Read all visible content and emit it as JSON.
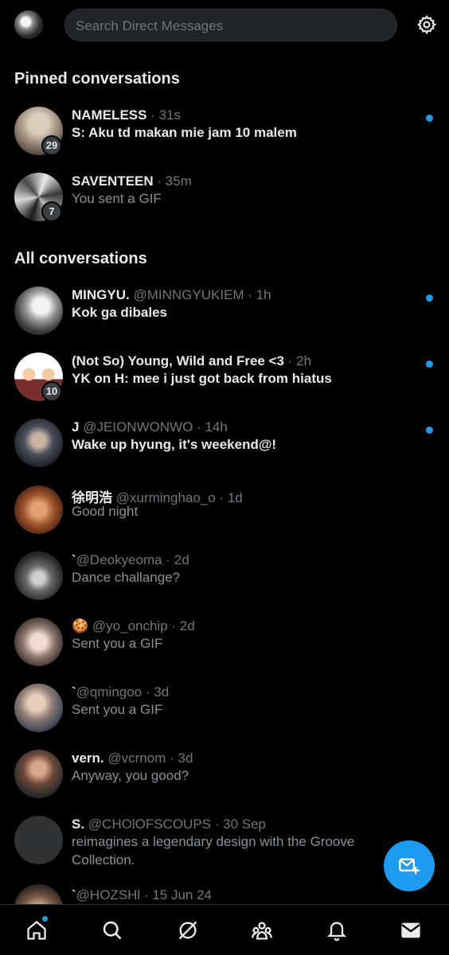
{
  "header": {
    "search_placeholder": "Search Direct Messages"
  },
  "sections": {
    "pinned_title": "Pinned conversations",
    "all_title": "All conversations"
  },
  "pinned": [
    {
      "name": "NAMELESS",
      "handle": "",
      "time": "31s",
      "message": "S: Aku td makan mie jam 10 malem",
      "unread": true,
      "badge": "29"
    },
    {
      "name": "SAVENTEEN",
      "handle": "",
      "time": "35m",
      "message": "You sent a GIF",
      "unread": false,
      "badge": "7"
    }
  ],
  "conversations": [
    {
      "name": "MINGYU.",
      "handle": "@MINNGYUKIEM",
      "time": "1h",
      "message": "Kok ga dibales",
      "unread": true,
      "badge": ""
    },
    {
      "name": "(Not So) Young, Wild and Free <3",
      "handle": "",
      "time": "2h",
      "message": "YK on H: mee i just got back from hiatus",
      "unread": true,
      "badge": "10"
    },
    {
      "name": "J",
      "handle": "@JEIONWONWO",
      "time": "14h",
      "message": "Wake up hyung, it's weekend@!",
      "unread": true,
      "badge": ""
    },
    {
      "name": "徐明浩",
      "handle": "@xurminghao_o",
      "time": "1d",
      "message": "Good night",
      "unread": false,
      "badge": ""
    },
    {
      "name": "`",
      "handle": "@Deokyeoma",
      "time": "2d",
      "message": "Dance challange?",
      "unread": false,
      "badge": ""
    },
    {
      "name": "🍪",
      "handle": "@yo_onchip",
      "time": "2d",
      "message": "Sent you a GIF",
      "unread": false,
      "badge": ""
    },
    {
      "name": "`",
      "handle": "@qmingoo",
      "time": "3d",
      "message": "Sent you a GIF",
      "unread": false,
      "badge": ""
    },
    {
      "name": "vern.",
      "handle": "@vcrnom",
      "time": "3d",
      "message": "Anyway, you good?",
      "unread": false,
      "badge": ""
    },
    {
      "name": "S.",
      "handle": "@CHOlOFSCOUPS",
      "time": "30 Sep",
      "message": "reimagines a legendary design with the Groove",
      "message2": "Collection.",
      "unread": false,
      "badge": ""
    },
    {
      "name": "`",
      "handle": "@HOZSHl",
      "time": "15 Jun 24",
      "message": "",
      "unread": false,
      "badge": ""
    }
  ],
  "icons": {
    "settings": "gear-icon",
    "compose": "new-message-icon",
    "nav": [
      "home-icon",
      "search-icon",
      "grok-icon",
      "communities-icon",
      "notifications-icon",
      "messages-icon"
    ]
  },
  "colors": {
    "accent": "#1d9bf0",
    "background": "#000000",
    "secondary_text": "#71767b"
  }
}
